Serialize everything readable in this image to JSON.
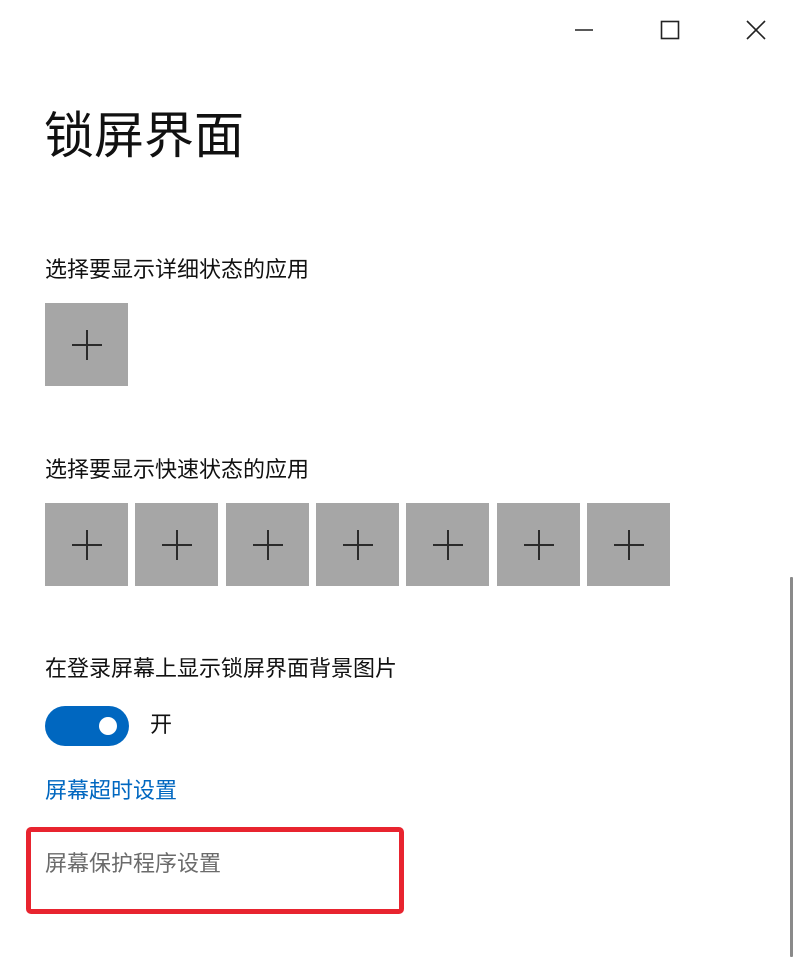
{
  "window": {
    "controls": {
      "minimize_icon": "minimize-icon",
      "maximize_icon": "maximize-icon",
      "close_icon": "close-icon"
    }
  },
  "page": {
    "title": "锁屏界面"
  },
  "detailed_status": {
    "label": "选择要显示详细状态的应用",
    "slot_icon": "plus-icon"
  },
  "quick_status": {
    "label": "选择要显示快速状态的应用",
    "slot_count": 7,
    "slot_icon": "plus-icon"
  },
  "login_background": {
    "label": "在登录屏幕上显示锁屏界面背景图片",
    "toggle_on": true,
    "toggle_state_label": "开"
  },
  "links": {
    "screen_timeout": "屏幕超时设置",
    "screen_saver": "屏幕保护程序设置"
  },
  "colors": {
    "accent": "#0067c0",
    "tile_bg": "#a6a6a6",
    "highlight": "#e8242f",
    "muted_link": "#6b6b6b"
  }
}
